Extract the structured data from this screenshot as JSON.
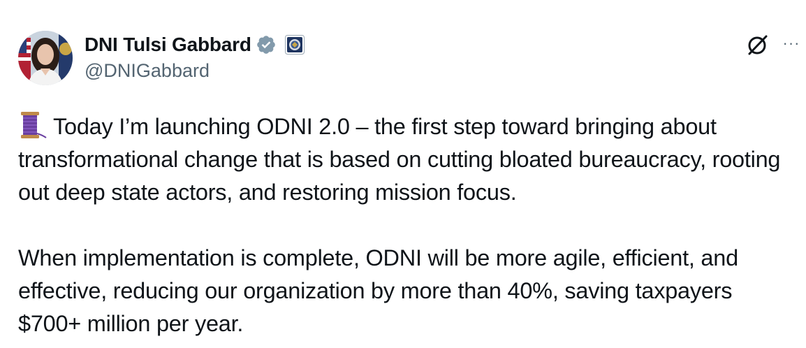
{
  "tweet": {
    "author": {
      "display_name": "DNI Tulsi Gabbard",
      "handle": "@DNIGabbard",
      "verified_icon": "verified-badge-icon",
      "affiliate_icon": "odni-seal-icon",
      "avatar_icon": "avatar-photo"
    },
    "actions": {
      "grok_icon": "grok-icon",
      "more_label": "···"
    },
    "body": {
      "emoji_icon": "thread-spool-emoji",
      "paragraphs": [
        "Today I’m launching ODNI 2.0 – the first step toward bringing about transformational change that is based on cutting bloated bureaucracy, rooting out deep state actors, and restoring mission focus.",
        "When implementation is complete, ODNI will be more agile, efficient, and effective, reducing our organization by more than 40%, saving taxpayers $700+ million per year."
      ]
    },
    "colors": {
      "text": "#0f1419",
      "secondary": "#536471",
      "verified_badge": "#829aab"
    }
  }
}
